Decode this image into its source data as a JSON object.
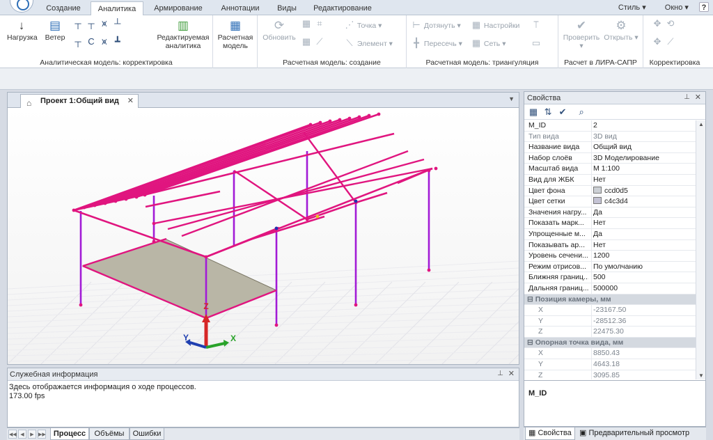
{
  "ribbon_tabs": [
    {
      "label": "Создание",
      "active": false
    },
    {
      "label": "Аналитика",
      "active": true
    },
    {
      "label": "Армирование",
      "active": false
    },
    {
      "label": "Аннотации",
      "active": false
    },
    {
      "label": "Виды",
      "active": false
    },
    {
      "label": "Редактирование",
      "active": false
    }
  ],
  "title_right": {
    "style": "Стиль",
    "window": "Окно",
    "help": "?"
  },
  "ribbon": {
    "group_analytic": {
      "label": "Аналитическая модель: корректировка",
      "load": "Нагрузка",
      "wind": "Ветер",
      "edit_analytic": "Редактируемая аналитика"
    },
    "group_calc_model": {
      "label": "",
      "button": "Расчетная модель"
    },
    "group_create": {
      "label": "Расчетная модель: создание",
      "update": "Обновить",
      "point": "Точка",
      "element": "Элемент"
    },
    "group_triang": {
      "label": "Расчетная модель: триангуляция",
      "extend": "Дотянуть",
      "intersect": "Пересечь",
      "settings": "Настройки",
      "mesh": "Сеть"
    },
    "group_lira": {
      "label": "Расчет в ЛИРА-САПР",
      "check": "Проверить",
      "open": "Открыть"
    },
    "group_correct": {
      "label": "Корректировка"
    }
  },
  "document": {
    "tab_title": "Проект 1:Общий вид"
  },
  "axes": {
    "x": "X",
    "y": "Y",
    "z": "Z"
  },
  "colors": {
    "frame": "#e0157f",
    "columns": "#a21bd6",
    "slab": "#b9b6a6",
    "grid": "#c4c3d4"
  },
  "output": {
    "title": "Служебная информация",
    "lines": [
      "Здесь отображается информация о ходе процессов.",
      "173.00 fps"
    ]
  },
  "bottom_tabs": [
    "Процесс",
    "Объёмы",
    "Ошибки"
  ],
  "properties": {
    "title": "Свойства",
    "rows": [
      {
        "name": "M_ID",
        "value": "2",
        "ro": false
      },
      {
        "name": "Тип вида",
        "value": "3D вид",
        "ro": true
      },
      {
        "name": "Название вида",
        "value": "Общий вид",
        "ro": false
      },
      {
        "name": "Набор слоёв",
        "value": "3D Моделирование",
        "ro": false
      },
      {
        "name": "Масштаб вида",
        "value": "М 1:100",
        "ro": false
      },
      {
        "name": "Вид для ЖБК",
        "value": "Нет",
        "ro": false
      },
      {
        "name": "Цвет фона",
        "value": "ccd0d5",
        "ro": false
      },
      {
        "name": "Цвет сетки",
        "value": "c4c3d4",
        "ro": false
      },
      {
        "name": "Значения нагру...",
        "value": "Да",
        "ro": false
      },
      {
        "name": "Показать марк...",
        "value": "Нет",
        "ro": false
      },
      {
        "name": "Упрощенные м...",
        "value": "Да",
        "ro": false
      },
      {
        "name": "Показывать ар...",
        "value": "Нет",
        "ro": false
      },
      {
        "name": "Уровень сечени...",
        "value": "1200",
        "ro": false
      },
      {
        "name": "Режим отрисов...",
        "value": "По умолчанию",
        "ro": false
      },
      {
        "name": "Ближняя границ...",
        "value": "500",
        "ro": false
      },
      {
        "name": "Дальняя границ...",
        "value": "500000",
        "ro": false
      }
    ],
    "camera_title": "Позиция камеры, мм",
    "camera": [
      {
        "name": "X",
        "value": "-23167.50"
      },
      {
        "name": "Y",
        "value": "-28512.36"
      },
      {
        "name": "Z",
        "value": "22475.30"
      }
    ],
    "target_title": "Опорная точка вида, мм",
    "target": [
      {
        "name": "X",
        "value": "8850.43"
      },
      {
        "name": "Y",
        "value": "4643.18"
      },
      {
        "name": "Z",
        "value": "3095.85"
      }
    ],
    "description": "M_ID"
  },
  "props_tabs": [
    "Свойства",
    "Предварительный просмотр"
  ]
}
